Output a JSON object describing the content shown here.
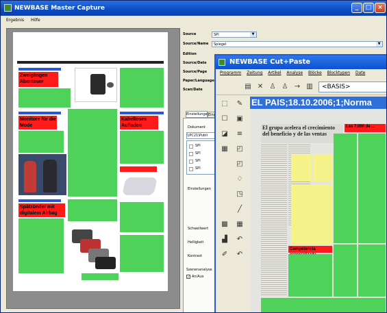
{
  "window": {
    "title": "NEWBASE Master Capture",
    "menu": [
      "Ergebnis",
      "Hilfe"
    ]
  },
  "preview_page": {
    "header_band": "",
    "articles": [
      {
        "headline": "Zweigängen Abenteuer"
      },
      {
        "headline": "Monitore für die Mode"
      },
      {
        "headline": "Kabelloses Aufladen"
      },
      {
        "headline": "Spätzünder mit digitalem Airbag"
      }
    ]
  },
  "properties": {
    "rows": [
      {
        "label": "Source",
        "value": "SPI"
      },
      {
        "label": "Source/Name",
        "value": "Spiegel"
      },
      {
        "label": "Edition",
        "value": ""
      },
      {
        "label": "Source/Date",
        "value": ""
      },
      {
        "label": "Source/Page",
        "value": ""
      },
      {
        "label": "Paper/Language",
        "value": ""
      },
      {
        "label": "Scan/Date",
        "value": ""
      }
    ],
    "tabs": [
      "Einstellungen",
      "Eingabe"
    ],
    "document_label": "Dokument",
    "document_path": "\\\\PC21\\Publi",
    "list_items": [
      "SPI",
      "SPI",
      "SPI",
      "SPI"
    ],
    "settings_label": "Einstellungen",
    "threshold_label": "Schwellwert",
    "brightness_label": "Helligkeit",
    "contrast_label": "Kontrast",
    "scene_analysis_label": "Szenenanalyse",
    "auto_checkbox_label": "An/Aus"
  },
  "cutpaste": {
    "title": "NEWBASE Cut+Paste",
    "menu": [
      "Programm",
      "Zeitung",
      "Artikel",
      "Analyse",
      "Blöcke",
      "Blocktypen",
      "Date"
    ],
    "toolbar_field": "<BASIS>",
    "document_header": "EL PAIS;18.10.2006;1;Norma",
    "headline": "El grupo acelera el crecimiento del beneficio y de las ventas",
    "side_headline": "Las 7.000 de ... ",
    "bottom_headline": "Competencia especializada"
  },
  "colors": {
    "xp_blue": "#0a4bc4",
    "article_green": "#4fd25a",
    "headline_red": "#ff1a1a",
    "title_blue": "#2f6fd8",
    "news_yellow": "#f5f28a"
  }
}
